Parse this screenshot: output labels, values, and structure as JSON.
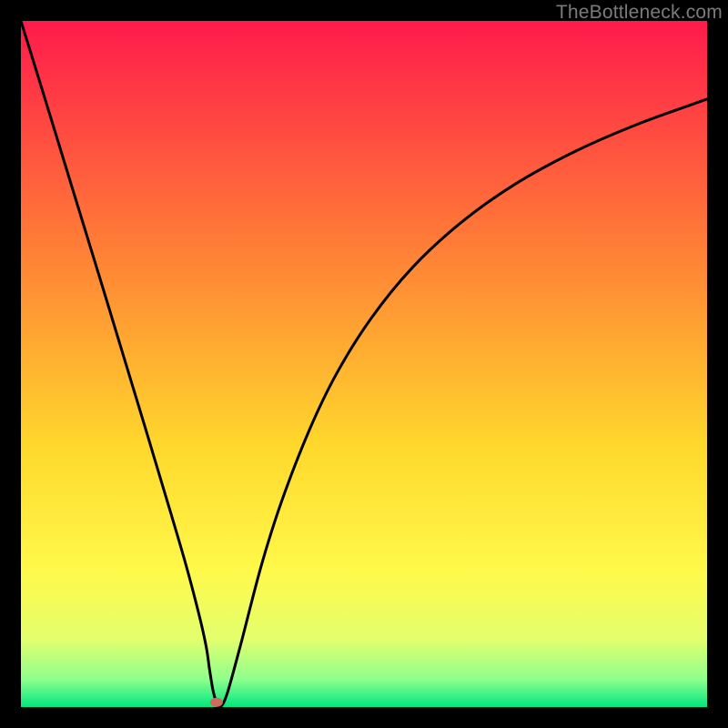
{
  "watermark": "TheBottleneck.com",
  "chart_data": {
    "type": "line",
    "title": "",
    "xlabel": "",
    "ylabel": "",
    "xlim": [
      0,
      100
    ],
    "ylim": [
      0,
      100
    ],
    "gradient_stops": [
      {
        "offset": 0.0,
        "color": "#ff1a4b"
      },
      {
        "offset": 0.33,
        "color": "#ff7e36"
      },
      {
        "offset": 0.62,
        "color": "#ffd82c"
      },
      {
        "offset": 0.8,
        "color": "#fff94a"
      },
      {
        "offset": 0.9,
        "color": "#e4ff6d"
      },
      {
        "offset": 0.96,
        "color": "#8dff8d"
      },
      {
        "offset": 1.0,
        "color": "#00e77f"
      }
    ],
    "series": [
      {
        "name": "bottleneck-curve",
        "x": [
          0,
          3,
          6,
          9,
          12,
          15,
          18,
          21,
          24,
          26,
          27,
          27.5,
          28,
          28.5,
          29,
          30,
          32,
          35,
          38,
          42,
          46,
          51,
          57,
          64,
          72,
          81,
          90,
          100
        ],
        "y": [
          100,
          90.3,
          80.5,
          70.7,
          60.9,
          51.0,
          41.1,
          31.1,
          20.9,
          13.3,
          8.8,
          5.4,
          2.4,
          0.7,
          0.0,
          1.8,
          9.0,
          20.5,
          30.0,
          40.3,
          48.6,
          56.6,
          64.0,
          70.5,
          76.2,
          81.1,
          85.0,
          88.6
        ]
      }
    ],
    "marker": {
      "x": 28.5,
      "y": 0.7,
      "color": "#d2695e"
    }
  }
}
